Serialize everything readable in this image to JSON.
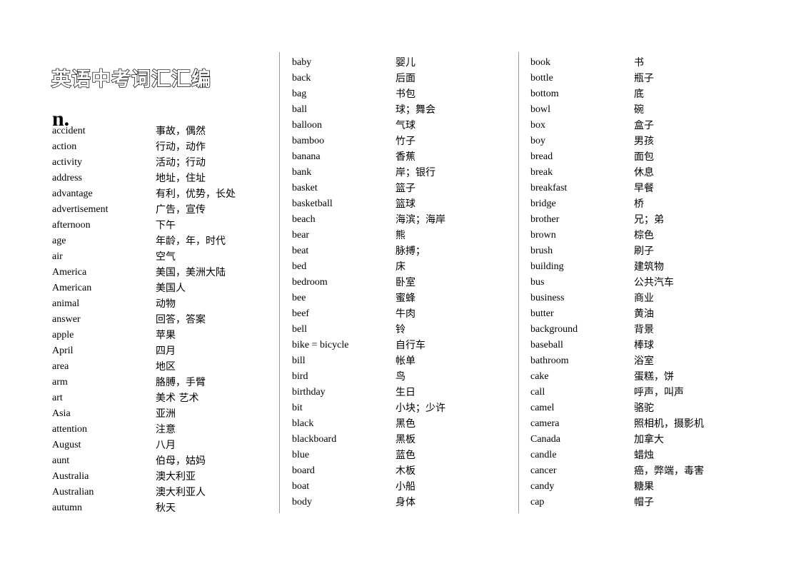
{
  "document": {
    "title": "英语中考词汇汇编",
    "part_of_speech_heading": "n."
  },
  "columns": [
    {
      "id": "column-1",
      "entries": [
        {
          "word": "accident",
          "meaning": "事故，偶然"
        },
        {
          "word": "action",
          "meaning": "行动，动作"
        },
        {
          "word": "activity",
          "meaning": "活动；行动"
        },
        {
          "word": "address",
          "meaning": "地址，住址"
        },
        {
          "word": "advantage",
          "meaning": "有利，优势，长处"
        },
        {
          "word": "advertisement",
          "meaning": "广告，宣传"
        },
        {
          "word": "afternoon",
          "meaning": "下午"
        },
        {
          "word": "age",
          "meaning": "年龄，年，时代"
        },
        {
          "word": "air",
          "meaning": "空气"
        },
        {
          "word": "America",
          "meaning": "美国，美洲大陆"
        },
        {
          "word": "American",
          "meaning": "美国人"
        },
        {
          "word": "animal",
          "meaning": "动物"
        },
        {
          "word": "answer",
          "meaning": "回答，答案"
        },
        {
          "word": "apple",
          "meaning": "苹果"
        },
        {
          "word": "April",
          "meaning": "四月"
        },
        {
          "word": "area",
          "meaning": "地区"
        },
        {
          "word": "arm",
          "meaning": "胳膊，手臂"
        },
        {
          "word": "art",
          "meaning": "美术 艺术"
        },
        {
          "word": "Asia",
          "meaning": "亚洲"
        },
        {
          "word": "attention",
          "meaning": "注意"
        },
        {
          "word": "August",
          "meaning": "八月"
        },
        {
          "word": "aunt",
          "meaning": "伯母，姑妈"
        },
        {
          "word": "Australia",
          "meaning": "澳大利亚"
        },
        {
          "word": "Australian",
          "meaning": "澳大利亚人"
        },
        {
          "word": "autumn",
          "meaning": "秋天"
        }
      ]
    },
    {
      "id": "column-2",
      "entries": [
        {
          "word": "baby",
          "meaning": "婴儿"
        },
        {
          "word": "back",
          "meaning": "后面"
        },
        {
          "word": "bag",
          "meaning": "书包"
        },
        {
          "word": "ball",
          "meaning": "球；舞会"
        },
        {
          "word": "balloon",
          "meaning": "气球"
        },
        {
          "word": "bamboo",
          "meaning": "竹子"
        },
        {
          "word": "banana",
          "meaning": "香蕉"
        },
        {
          "word": "bank",
          "meaning": "岸；银行"
        },
        {
          "word": "basket",
          "meaning": "篮子"
        },
        {
          "word": "basketball",
          "meaning": "篮球"
        },
        {
          "word": "beach",
          "meaning": "海滨；海岸"
        },
        {
          "word": "bear",
          "meaning": "熊"
        },
        {
          "word": "beat",
          "meaning": "脉搏；"
        },
        {
          "word": "bed",
          "meaning": "床"
        },
        {
          "word": "bedroom",
          "meaning": "卧室"
        },
        {
          "word": "bee",
          "meaning": "蜜蜂"
        },
        {
          "word": "beef",
          "meaning": "牛肉"
        },
        {
          "word": "bell",
          "meaning": "铃"
        },
        {
          "word": "bike = bicycle",
          "meaning": "自行车"
        },
        {
          "word": "bill",
          "meaning": "帐单"
        },
        {
          "word": "bird",
          "meaning": "鸟"
        },
        {
          "word": "birthday",
          "meaning": "生日"
        },
        {
          "word": "bit",
          "meaning": "小块；少许"
        },
        {
          "word": "black",
          "meaning": "黑色"
        },
        {
          "word": "blackboard",
          "meaning": "黑板"
        },
        {
          "word": "blue",
          "meaning": "蓝色"
        },
        {
          "word": "board",
          "meaning": "木板"
        },
        {
          "word": "boat",
          "meaning": "小船"
        },
        {
          "word": "body",
          "meaning": "身体"
        }
      ]
    },
    {
      "id": "column-3",
      "entries": [
        {
          "word": "book",
          "meaning": "书"
        },
        {
          "word": "bottle",
          "meaning": "瓶子"
        },
        {
          "word": "bottom",
          "meaning": "底"
        },
        {
          "word": "bowl",
          "meaning": "碗"
        },
        {
          "word": "box",
          "meaning": "盒子"
        },
        {
          "word": "boy",
          "meaning": "男孩"
        },
        {
          "word": "bread",
          "meaning": "面包"
        },
        {
          "word": "break",
          "meaning": "休息"
        },
        {
          "word": "breakfast",
          "meaning": "早餐"
        },
        {
          "word": "bridge",
          "meaning": "桥"
        },
        {
          "word": "brother",
          "meaning": "兄；弟"
        },
        {
          "word": "brown",
          "meaning": "棕色"
        },
        {
          "word": "brush",
          "meaning": "刷子"
        },
        {
          "word": "building",
          "meaning": "建筑物"
        },
        {
          "word": "bus",
          "meaning": "公共汽车"
        },
        {
          "word": "business",
          "meaning": "商业"
        },
        {
          "word": "butter",
          "meaning": "黄油"
        },
        {
          "word": "background",
          "meaning": "背景"
        },
        {
          "word": "baseball",
          "meaning": "棒球"
        },
        {
          "word": "bathroom",
          "meaning": "浴室"
        },
        {
          "word": "cake",
          "meaning": "蛋糕，饼"
        },
        {
          "word": "call",
          "meaning": "呼声，叫声"
        },
        {
          "word": "camel",
          "meaning": "骆驼"
        },
        {
          "word": "camera",
          "meaning": "照相机，摄影机"
        },
        {
          "word": "Canada",
          "meaning": "加拿大"
        },
        {
          "word": "candle",
          "meaning": "蜡烛"
        },
        {
          "word": "cancer",
          "meaning": "癌，弊端，毒害"
        },
        {
          "word": "candy",
          "meaning": "糖果"
        },
        {
          "word": "cap",
          "meaning": "帽子"
        }
      ]
    }
  ]
}
